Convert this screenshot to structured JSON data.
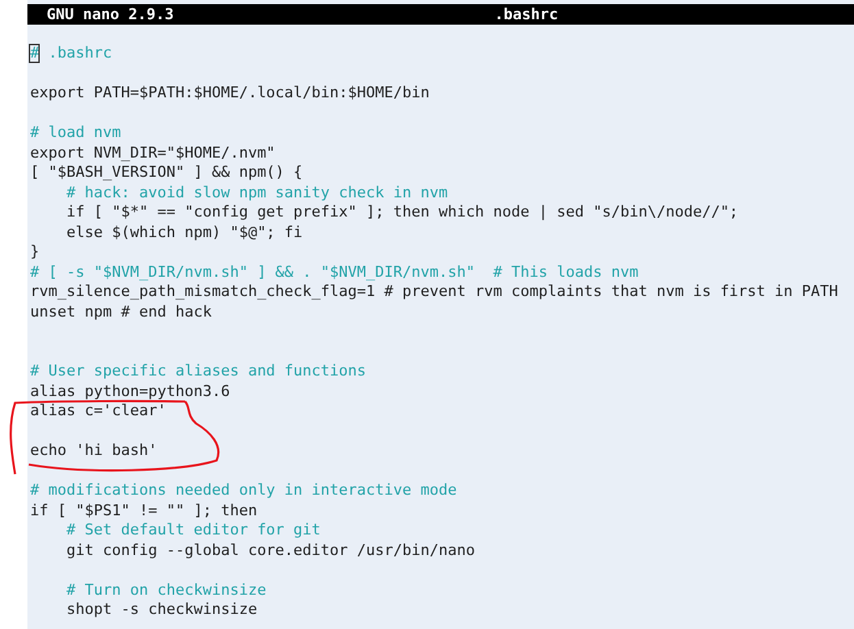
{
  "title_bar": {
    "app": "GNU nano 2.9.3",
    "file": ".bashrc"
  },
  "lines": [
    {
      "kind": "comment",
      "text": "# .bashrc",
      "cursor": true
    },
    {
      "kind": "blank"
    },
    {
      "kind": "code",
      "text": "export PATH=$PATH:$HOME/.local/bin:$HOME/bin"
    },
    {
      "kind": "blank"
    },
    {
      "kind": "comment",
      "text": "# load nvm"
    },
    {
      "kind": "code",
      "text": "export NVM_DIR=\"$HOME/.nvm\""
    },
    {
      "kind": "code",
      "text": "[ \"$BASH_VERSION\" ] && npm() {"
    },
    {
      "kind": "comment",
      "text": "    # hack: avoid slow npm sanity check in nvm"
    },
    {
      "kind": "code",
      "text": "    if [ \"$*\" == \"config get prefix\" ]; then which node | sed \"s/bin\\/node//\";"
    },
    {
      "kind": "code",
      "text": "    else $(which npm) \"$@\"; fi"
    },
    {
      "kind": "code",
      "text": "}"
    },
    {
      "kind": "comment",
      "text": "# [ -s \"$NVM_DIR/nvm.sh\" ] && . \"$NVM_DIR/nvm.sh\"  # This loads nvm"
    },
    {
      "kind": "code",
      "text": "rvm_silence_path_mismatch_check_flag=1 # prevent rvm complaints that nvm is first in PATH"
    },
    {
      "kind": "code",
      "text": "unset npm # end hack"
    },
    {
      "kind": "blank"
    },
    {
      "kind": "blank"
    },
    {
      "kind": "comment",
      "text": "# User specific aliases and functions"
    },
    {
      "kind": "code",
      "text": "alias python=python3.6"
    },
    {
      "kind": "code",
      "text": "alias c='clear'"
    },
    {
      "kind": "blank"
    },
    {
      "kind": "code",
      "text": "echo 'hi bash'"
    },
    {
      "kind": "blank"
    },
    {
      "kind": "comment",
      "text": "# modifications needed only in interactive mode"
    },
    {
      "kind": "code",
      "text": "if [ \"$PS1\" != \"\" ]; then"
    },
    {
      "kind": "comment",
      "text": "    # Set default editor for git"
    },
    {
      "kind": "code",
      "text": "    git config --global core.editor /usr/bin/nano"
    },
    {
      "kind": "blank"
    },
    {
      "kind": "comment",
      "text": "    # Turn on checkwinsize"
    },
    {
      "kind": "code",
      "text": "    shopt -s checkwinsize"
    }
  ]
}
